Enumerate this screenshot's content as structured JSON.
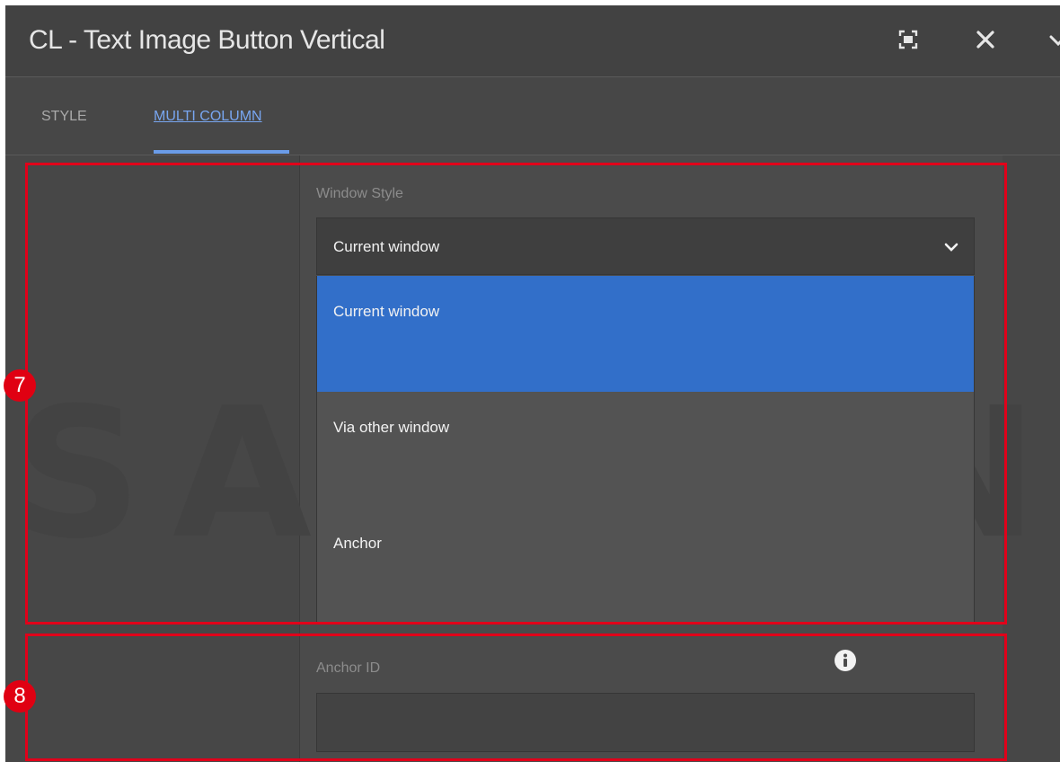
{
  "dialog": {
    "title": "CL - Text Image Button Vertical",
    "icons": [
      "fullscreen-icon",
      "close-icon",
      "chevron-down-icon"
    ]
  },
  "tabs": [
    {
      "label": "STYLE",
      "active": false
    },
    {
      "label": "MULTI COLUMN",
      "active": true
    }
  ],
  "window_style": {
    "label": "Window Style",
    "value": "Current window",
    "options": [
      "Current window",
      "Via other window",
      "Anchor"
    ],
    "selected_index": 0
  },
  "anchor_id": {
    "label": "Anchor ID",
    "value": "",
    "icon": "info-icon"
  },
  "watermark": "SAMSUNG",
  "annotations": {
    "markers": [
      "7",
      "8"
    ],
    "color": "#e1001a"
  },
  "colors": {
    "accent": "#326fc9",
    "tab_active": "#78a6f0",
    "background": "#4b4b4b"
  }
}
